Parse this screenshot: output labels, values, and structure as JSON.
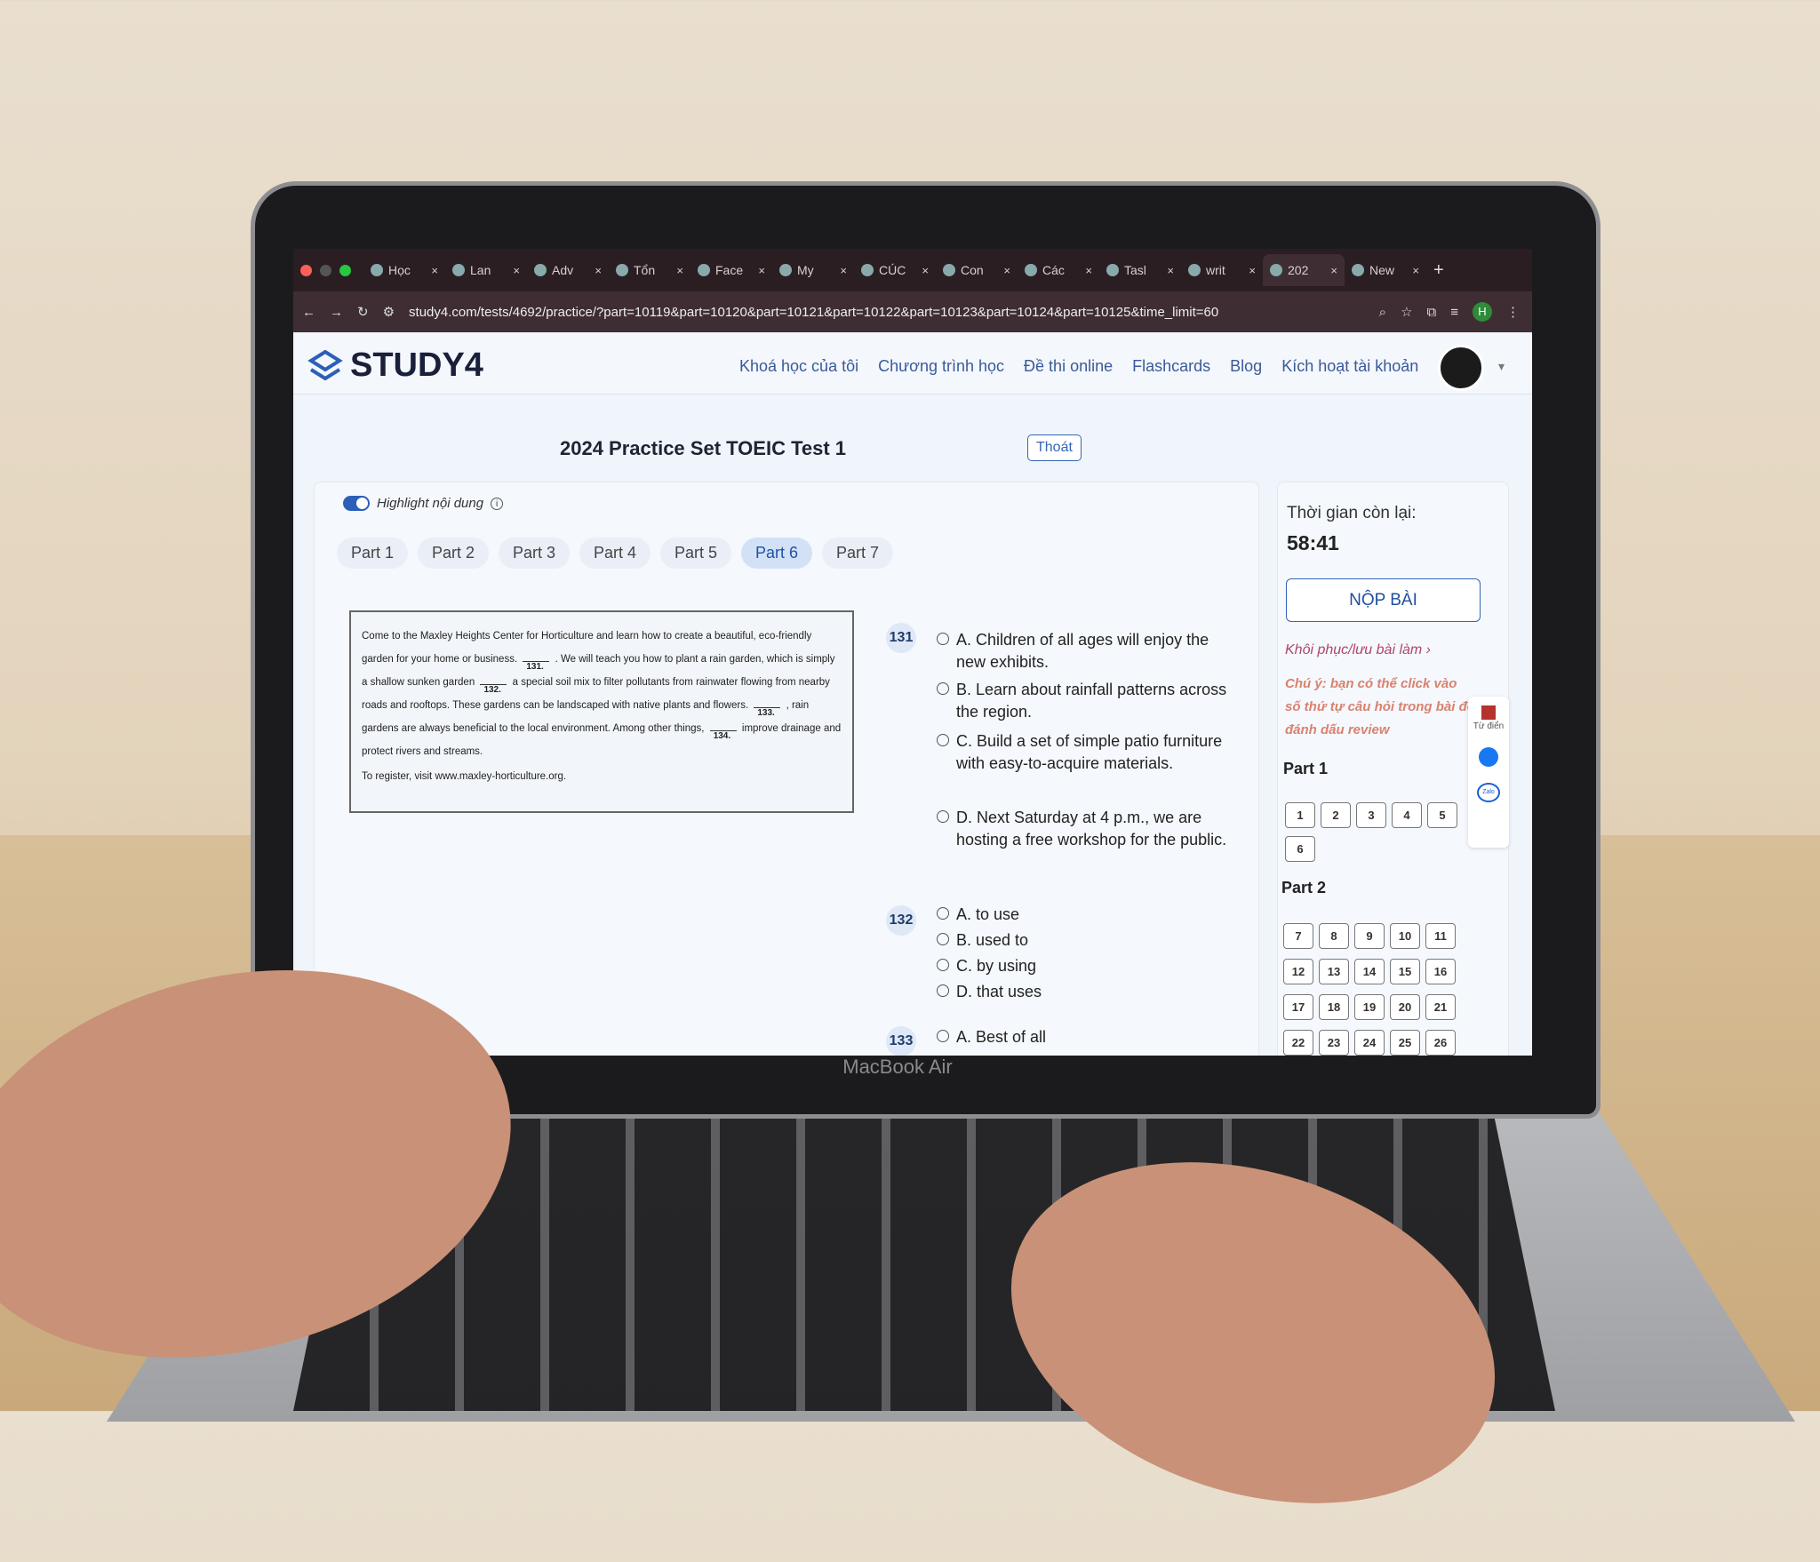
{
  "browser": {
    "tabs": [
      {
        "label": "Học"
      },
      {
        "label": "Lan"
      },
      {
        "label": "Adv"
      },
      {
        "label": "Tổn"
      },
      {
        "label": "Face"
      },
      {
        "label": "My"
      },
      {
        "label": "CÚC"
      },
      {
        "label": "Con"
      },
      {
        "label": "Các"
      },
      {
        "label": "Tasl"
      },
      {
        "label": "writ"
      },
      {
        "label": "202",
        "active": true
      },
      {
        "label": "New"
      }
    ],
    "new_tab": "+",
    "url": "study4.com/tests/4692/practice/?part=10119&part=10120&part=10121&part=10122&part=10123&part=10124&part=10125&time_limit=60",
    "profile": "H"
  },
  "header": {
    "logo": "STUDY4",
    "nav": [
      "Khoá học của tôi",
      "Chương trình học",
      "Đề thi online",
      "Flashcards",
      "Blog",
      "Kích hoạt tài khoản"
    ]
  },
  "test": {
    "title": "2024 Practice Set TOEIC Test 1",
    "exit_label": "Thoát",
    "highlight_label": "Highlight nội dung",
    "highlight_on": true,
    "parts": [
      "Part 1",
      "Part 2",
      "Part 3",
      "Part 4",
      "Part 5",
      "Part 6",
      "Part 7"
    ],
    "active_part": "Part 6"
  },
  "passage": {
    "s1": "Come to the Maxley Heights Center for Horticulture and learn how to create a beautiful, eco-friendly garden for your home or business.",
    "b1": "131.",
    "s2": ". We will teach you how to plant a rain garden, which is simply a shallow sunken garden",
    "b2": "132.",
    "s3": "a special soil mix to filter pollutants from rainwater flowing from nearby roads and rooftops. These gardens can be landscaped with native plants and flowers.",
    "b3": "133.",
    "s4": ", rain gardens are always beneficial to the local environment. Among other things,",
    "b4": "134.",
    "s5": "improve drainage and protect rivers and streams.",
    "register": "To register, visit www.maxley-horticulture.org."
  },
  "questions": [
    {
      "num": "131",
      "options": [
        "A. Children of all ages will enjoy the new exhibits.",
        "B. Learn about rainfall patterns across the region.",
        "C. Build a set of simple patio furniture with easy-to-acquire materials.",
        "D. Next Saturday at 4 p.m., we are hosting a free workshop for the public."
      ]
    },
    {
      "num": "132",
      "options": [
        "A. to use",
        "B. used to",
        "C. by using",
        "D. that uses"
      ]
    },
    {
      "num": "133",
      "options": [
        "A. Best of all"
      ]
    }
  ],
  "sidebar": {
    "time_label": "Thời gian còn lại:",
    "time": "58:41",
    "submit": "NỘP BÀI",
    "restore": "Khôi phục/lưu bài làm",
    "note": "Chú ý: bạn có thể click vào số thứ tự câu hỏi trong bài để đánh dấu review",
    "part1_label": "Part 1",
    "part1": [
      "1",
      "2",
      "3",
      "4",
      "5",
      "6"
    ],
    "part2_label": "Part 2",
    "part2": [
      "7",
      "8",
      "9",
      "10",
      "11",
      "12",
      "13",
      "14",
      "15",
      "16",
      "17",
      "18",
      "19",
      "20",
      "21",
      "22",
      "23",
      "24",
      "25",
      "26"
    ],
    "widget_dict": "Từ điển",
    "widget_zalo": "Zalo"
  },
  "device": {
    "label": "MacBook Air"
  },
  "colors": {
    "accent": "#2b5fb8",
    "note": "#d9826e",
    "restore": "#b0466a"
  }
}
